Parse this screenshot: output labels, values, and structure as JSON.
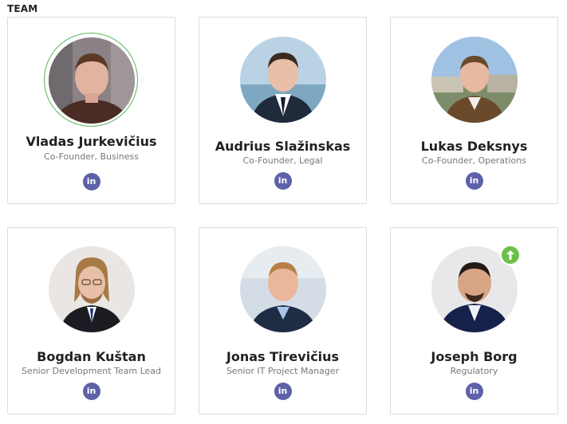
{
  "section": {
    "title": "TEAM"
  },
  "members": [
    {
      "name": "Vladas Jurkevičius",
      "role": "Co-Founder, Business",
      "linkedin": "in",
      "highlighted": true
    },
    {
      "name": "Audrius Slažinskas",
      "role": "Co-Founder, Legal",
      "linkedin": "in"
    },
    {
      "name": "Lukas Deksnys",
      "role": "Co-Founder, Operations",
      "linkedin": "in"
    },
    {
      "name": "Bogdan Kuštan",
      "role": "Senior Development Team Lead",
      "linkedin": "in"
    },
    {
      "name": "Jonas Tirevičius",
      "role": "Senior IT Project Manager",
      "linkedin": "in"
    },
    {
      "name": "Joseph Borg",
      "role": "Regulatory",
      "linkedin": "in",
      "badge": "arrow-up-icon"
    }
  ],
  "colors": {
    "linkedin": "#5d61a8",
    "highlight_ring": "#5cb85c",
    "badge": "#6cc04a"
  }
}
